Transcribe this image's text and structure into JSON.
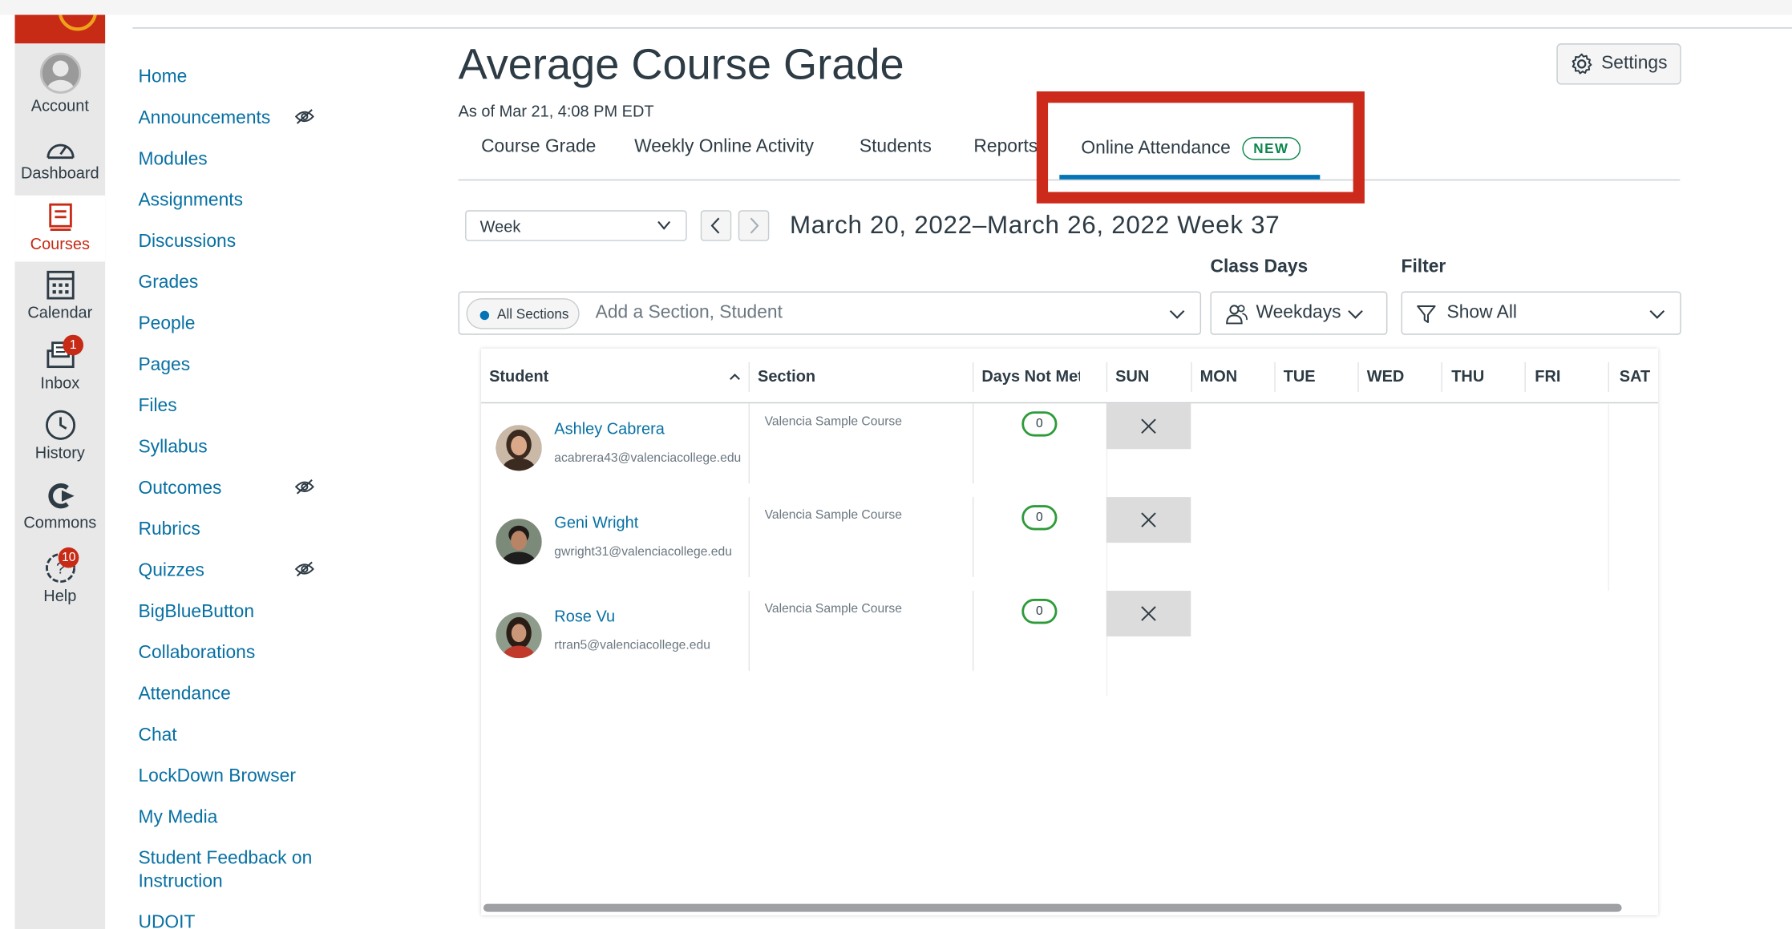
{
  "global_nav": {
    "items": [
      {
        "label": "Account",
        "icon": "account-avatar-icon"
      },
      {
        "label": "Dashboard",
        "icon": "dashboard-gauge-icon"
      },
      {
        "label": "Courses",
        "icon": "courses-book-icon",
        "active": true
      },
      {
        "label": "Calendar",
        "icon": "calendar-icon"
      },
      {
        "label": "Inbox",
        "icon": "inbox-icon",
        "badge": "1"
      },
      {
        "label": "History",
        "icon": "history-clock-icon"
      },
      {
        "label": "Commons",
        "icon": "commons-arrow-icon"
      },
      {
        "label": "Help",
        "icon": "help-question-icon",
        "badge": "10"
      }
    ]
  },
  "course_nav": {
    "items": [
      {
        "label": "Home"
      },
      {
        "label": "Announcements",
        "hidden_icon": true
      },
      {
        "label": "Modules"
      },
      {
        "label": "Assignments"
      },
      {
        "label": "Discussions"
      },
      {
        "label": "Grades"
      },
      {
        "label": "People"
      },
      {
        "label": "Pages"
      },
      {
        "label": "Files"
      },
      {
        "label": "Syllabus"
      },
      {
        "label": "Outcomes",
        "hidden_icon": true
      },
      {
        "label": "Rubrics"
      },
      {
        "label": "Quizzes",
        "hidden_icon": true
      },
      {
        "label": "BigBlueButton"
      },
      {
        "label": "Collaborations"
      },
      {
        "label": "Attendance"
      },
      {
        "label": "Chat"
      },
      {
        "label": "LockDown Browser"
      },
      {
        "label": "My Media"
      },
      {
        "label": "Student Feedback on",
        "label2": "Instruction"
      },
      {
        "label": "UDOIT"
      }
    ]
  },
  "header": {
    "title": "Average Course Grade",
    "as_of": "As of Mar 21, 4:08 PM EDT",
    "settings_label": "Settings"
  },
  "tabs": [
    {
      "label": "Course Grade"
    },
    {
      "label": "Weekly Online Activity"
    },
    {
      "label": "Students"
    },
    {
      "label": "Reports"
    },
    {
      "label": "Online Attendance",
      "badge": "NEW",
      "active": true
    }
  ],
  "toolbar": {
    "period_value": "Week",
    "date_range": "March 20, 2022–March 26, 2022 Week 37"
  },
  "filters": {
    "section_chip": "All Sections",
    "section_placeholder": "Add a Section, Student",
    "class_days_label": "Class Days",
    "class_days_value": "Weekdays",
    "filter_label": "Filter",
    "filter_value": "Show All"
  },
  "table": {
    "columns": [
      "Student",
      "Section",
      "Days Not Met",
      "SUN",
      "MON",
      "TUE",
      "WED",
      "THU",
      "FRI",
      "SAT"
    ],
    "rows": [
      {
        "name": "Ashley Cabrera",
        "email": "acabrera43@valenciacollege.edu",
        "section": "Valencia Sample Course",
        "days_not_met": "0"
      },
      {
        "name": "Geni Wright",
        "email": "gwright31@valenciacollege.edu",
        "section": "Valencia Sample Course",
        "days_not_met": "0"
      },
      {
        "name": "Rose Vu",
        "email": "rtran5@valenciacollege.edu",
        "section": "Valencia Sample Course",
        "days_not_met": "0"
      }
    ]
  },
  "colors": {
    "brand_red": "#c72a15",
    "link_blue": "#0770a3",
    "active_tab": "#0374b5",
    "new_badge_green": "#0b874b",
    "highlight_box": "#cc2a1b"
  }
}
